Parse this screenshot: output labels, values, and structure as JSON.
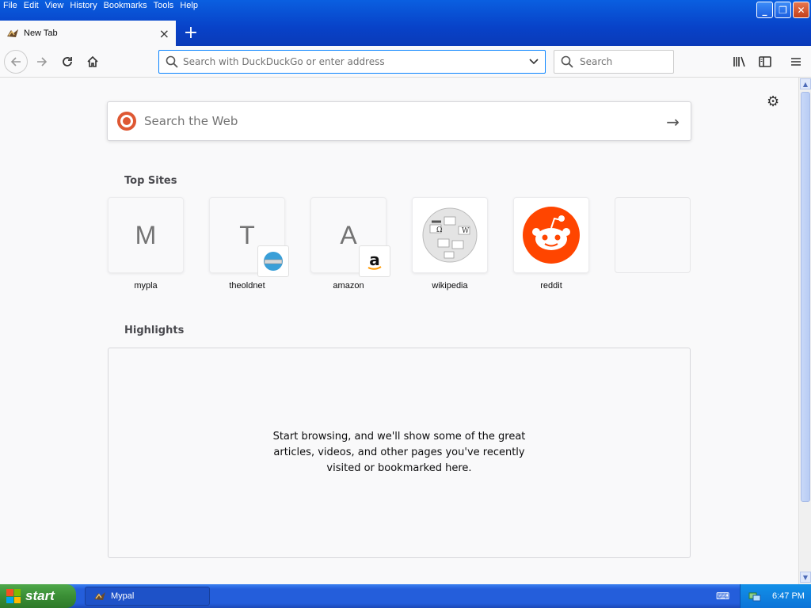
{
  "menubar": {
    "items": [
      "File",
      "Edit",
      "View",
      "History",
      "Bookmarks",
      "Tools",
      "Help"
    ]
  },
  "window": {
    "buttons": [
      "minimize",
      "restore",
      "close"
    ]
  },
  "tab": {
    "label": "New Tab",
    "close": "×",
    "new_tab": "+"
  },
  "nav": {
    "url_placeholder": "Search with DuckDuckGo or enter address",
    "search_placeholder": "Search"
  },
  "newtab": {
    "web_search_placeholder": "Search the Web",
    "top_sites_title": "Top Sites",
    "top_sites": [
      {
        "letter": "M",
        "label": "mypla"
      },
      {
        "letter": "T",
        "label": "theoldnet"
      },
      {
        "letter": "A",
        "label": "amazon"
      },
      {
        "letter": "",
        "label": "wikipedia"
      },
      {
        "letter": "",
        "label": "reddit"
      },
      {
        "letter": "",
        "label": ""
      }
    ],
    "highlights_title": "Highlights",
    "highlights_empty": "Start browsing, and we'll show some of the great articles, videos, and other pages you've recently visited or bookmarked here."
  },
  "taskbar": {
    "start_label": "start",
    "task_label": "Mypal",
    "clock": "6:47 PM"
  },
  "colors": {
    "titlebar": "#0842c8",
    "accent": "#0a84ff",
    "reddit": "#ff4500",
    "duckduckgo": "#de5833",
    "start": "#3a8e35"
  }
}
